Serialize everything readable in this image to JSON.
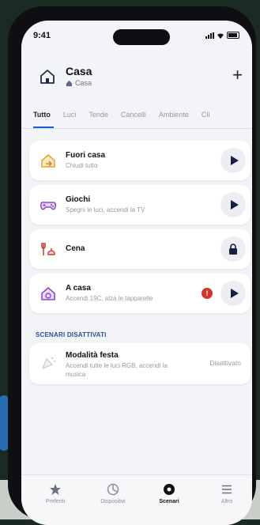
{
  "status_bar": {
    "time": "9:41"
  },
  "header": {
    "title": "Casa",
    "subtitle": "Casa",
    "add_label": "+"
  },
  "tabs": [
    {
      "label": "Tutto",
      "active": true
    },
    {
      "label": "Luci",
      "active": false
    },
    {
      "label": "Tende",
      "active": false
    },
    {
      "label": "Cancelli",
      "active": false
    },
    {
      "label": "Ambiente",
      "active": false
    },
    {
      "label": "Cli",
      "active": false
    }
  ],
  "scenarios": [
    {
      "name": "Fuori casa",
      "description": "Chiudi tutto",
      "icon": "house-leave-icon",
      "action": "play"
    },
    {
      "name": "Giochi",
      "description": "Spegni le luci, accendi la TV",
      "icon": "gamepad-icon",
      "action": "play"
    },
    {
      "name": "Cena",
      "description": "",
      "icon": "dinner-icon",
      "action": "lock"
    },
    {
      "name": "A casa",
      "description": "Accendi 19C, alza le tapparelle",
      "icon": "house-arrive-icon",
      "action": "play",
      "badge": "!"
    }
  ],
  "disabled_section": {
    "title": "SCENARI DISATTIVATI",
    "items": [
      {
        "name": "Modalità festa",
        "description": "Accendi tutte le luci RGB, accendi la musica",
        "status": "Disattivato",
        "icon": "party-icon"
      }
    ]
  },
  "navbar": {
    "items": [
      {
        "label": "Preferiti",
        "icon": "star-icon",
        "active": false
      },
      {
        "label": "Dispositivi",
        "icon": "devices-icon",
        "active": false
      },
      {
        "label": "Scenari",
        "icon": "scenarios-icon",
        "active": true
      },
      {
        "label": "Altro",
        "icon": "menu-icon",
        "active": false
      }
    ]
  },
  "colors": {
    "accent": "#1a5bd8",
    "section_title": "#2a4e9e",
    "badge": "#d0342c",
    "icon_orange": "#e8a23a",
    "icon_purple": "#8a4bc8",
    "icon_red": "#c8392f"
  }
}
